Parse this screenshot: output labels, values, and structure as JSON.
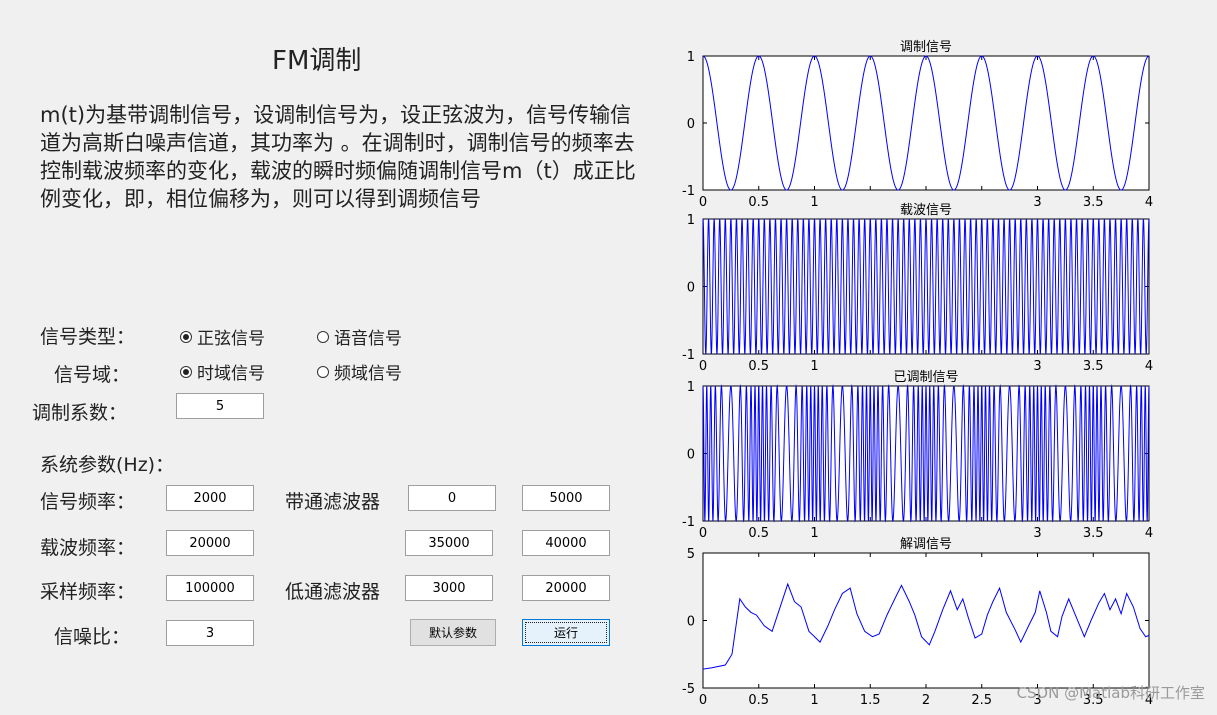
{
  "title": "FM调制",
  "description": "m(t)为基带调制信号，设调制信号为，设正弦波为，信号传输信道为高斯白噪声信道，其功率为 。在调制时，调制信号的频率去控制载波频率的变化，载波的瞬时频偏随调制信号m（t）成正比例变化，即，相位偏移为，则可以得到调频信号",
  "signal_type": {
    "label": "信号类型：",
    "options": [
      "正弦信号",
      "语音信号"
    ],
    "selected": "正弦信号"
  },
  "signal_domain": {
    "label": "信号域：",
    "options": [
      "时域信号",
      "频域信号"
    ],
    "selected": "时域信号"
  },
  "mod_index": {
    "label": "调制系数：",
    "value": "5"
  },
  "sys_params": {
    "label": "系统参数(Hz)："
  },
  "signal_freq": {
    "label": "信号频率：",
    "value": "2000"
  },
  "carrier_freq": {
    "label": "载波频率：",
    "value": "20000"
  },
  "sample_freq": {
    "label": "采样频率：",
    "value": "100000"
  },
  "snr": {
    "label": "信噪比：",
    "value": "3"
  },
  "bandpass": {
    "label": "带通滤波器",
    "values": [
      "0",
      "5000",
      "35000",
      "40000"
    ]
  },
  "lowpass": {
    "label": "低通滤波器",
    "values": [
      "3000",
      "20000"
    ]
  },
  "buttons": {
    "default": "默认参数",
    "run": "运行"
  },
  "watermark": "CSDN @Matlab科研工作室",
  "line_color": "#0000ff",
  "chart_data": [
    {
      "type": "line",
      "title": "调制信号",
      "xlim": [
        0,
        4
      ],
      "ylim": [
        -1,
        1
      ],
      "xticks": [
        "0",
        "0.5",
        "1",
        "",
        "",
        "",
        "3",
        "3.5",
        "4"
      ],
      "yticks": [
        "-1",
        "0",
        "1"
      ],
      "waveform": "cosine",
      "cycles": 8
    },
    {
      "type": "line",
      "title": "载波信号",
      "xlim": [
        0,
        4
      ],
      "ylim": [
        -1,
        1
      ],
      "xticks": [
        "0",
        "0.5",
        "1",
        "",
        "",
        "",
        "3",
        "3.5",
        "4"
      ],
      "yticks": [
        "-1",
        "0",
        "1"
      ],
      "waveform": "cosine",
      "cycles": 80
    },
    {
      "type": "line",
      "title": "已调制信号",
      "xlim": [
        0,
        4
      ],
      "ylim": [
        -1,
        1
      ],
      "xticks": [
        "0",
        "0.5",
        "1",
        "",
        "",
        "",
        "3",
        "3.5",
        "4"
      ],
      "yticks": [
        "-1",
        "0",
        "1"
      ],
      "waveform": "fm",
      "cycles": 80,
      "mod_cycles": 8,
      "mod_index": 5
    },
    {
      "type": "line",
      "title": "解调信号",
      "xlim": [
        0,
        4
      ],
      "ylim": [
        -5,
        5
      ],
      "xticks": [
        "0",
        "0.5",
        "1",
        "1.5",
        "2",
        "2.5",
        "3",
        "3.5",
        "4"
      ],
      "yticks": [
        "-5",
        "0",
        "5"
      ],
      "points": [
        [
          0,
          -3.6
        ],
        [
          0.08,
          -3.5
        ],
        [
          0.2,
          -3.3
        ],
        [
          0.26,
          -2.5
        ],
        [
          0.33,
          1.6
        ],
        [
          0.38,
          1.0
        ],
        [
          0.43,
          0.6
        ],
        [
          0.48,
          0.4
        ],
        [
          0.55,
          -0.4
        ],
        [
          0.62,
          -0.8
        ],
        [
          0.7,
          1.2
        ],
        [
          0.76,
          2.7
        ],
        [
          0.82,
          1.4
        ],
        [
          0.88,
          1.0
        ],
        [
          0.95,
          -0.8
        ],
        [
          1.05,
          -1.6
        ],
        [
          1.12,
          -0.4
        ],
        [
          1.18,
          0.8
        ],
        [
          1.25,
          2.0
        ],
        [
          1.32,
          2.4
        ],
        [
          1.38,
          0.5
        ],
        [
          1.45,
          -0.8
        ],
        [
          1.52,
          -1.2
        ],
        [
          1.58,
          -1.0
        ],
        [
          1.65,
          0.4
        ],
        [
          1.72,
          1.6
        ],
        [
          1.78,
          2.6
        ],
        [
          1.85,
          1.4
        ],
        [
          1.9,
          0.4
        ],
        [
          1.96,
          -1.2
        ],
        [
          2.03,
          -1.8
        ],
        [
          2.08,
          -0.8
        ],
        [
          2.15,
          0.8
        ],
        [
          2.22,
          2.2
        ],
        [
          2.28,
          0.8
        ],
        [
          2.33,
          1.6
        ],
        [
          2.38,
          0.2
        ],
        [
          2.44,
          -1.3
        ],
        [
          2.5,
          -1.0
        ],
        [
          2.55,
          0.4
        ],
        [
          2.6,
          1.4
        ],
        [
          2.66,
          2.4
        ],
        [
          2.72,
          0.6
        ],
        [
          2.8,
          -0.7
        ],
        [
          2.85,
          -1.6
        ],
        [
          2.92,
          -0.4
        ],
        [
          2.98,
          0.6
        ],
        [
          3.02,
          2.2
        ],
        [
          3.08,
          0.6
        ],
        [
          3.12,
          -0.8
        ],
        [
          3.18,
          -1.2
        ],
        [
          3.22,
          0.3
        ],
        [
          3.28,
          1.6
        ],
        [
          3.35,
          0.2
        ],
        [
          3.42,
          -1.2
        ],
        [
          3.48,
          0.0
        ],
        [
          3.55,
          1.3
        ],
        [
          3.6,
          2.0
        ],
        [
          3.65,
          0.8
        ],
        [
          3.7,
          1.6
        ],
        [
          3.75,
          0.5
        ],
        [
          3.8,
          2.0
        ],
        [
          3.86,
          1.0
        ],
        [
          3.92,
          -0.6
        ],
        [
          3.97,
          -1.2
        ],
        [
          4,
          -1.1
        ]
      ]
    }
  ]
}
